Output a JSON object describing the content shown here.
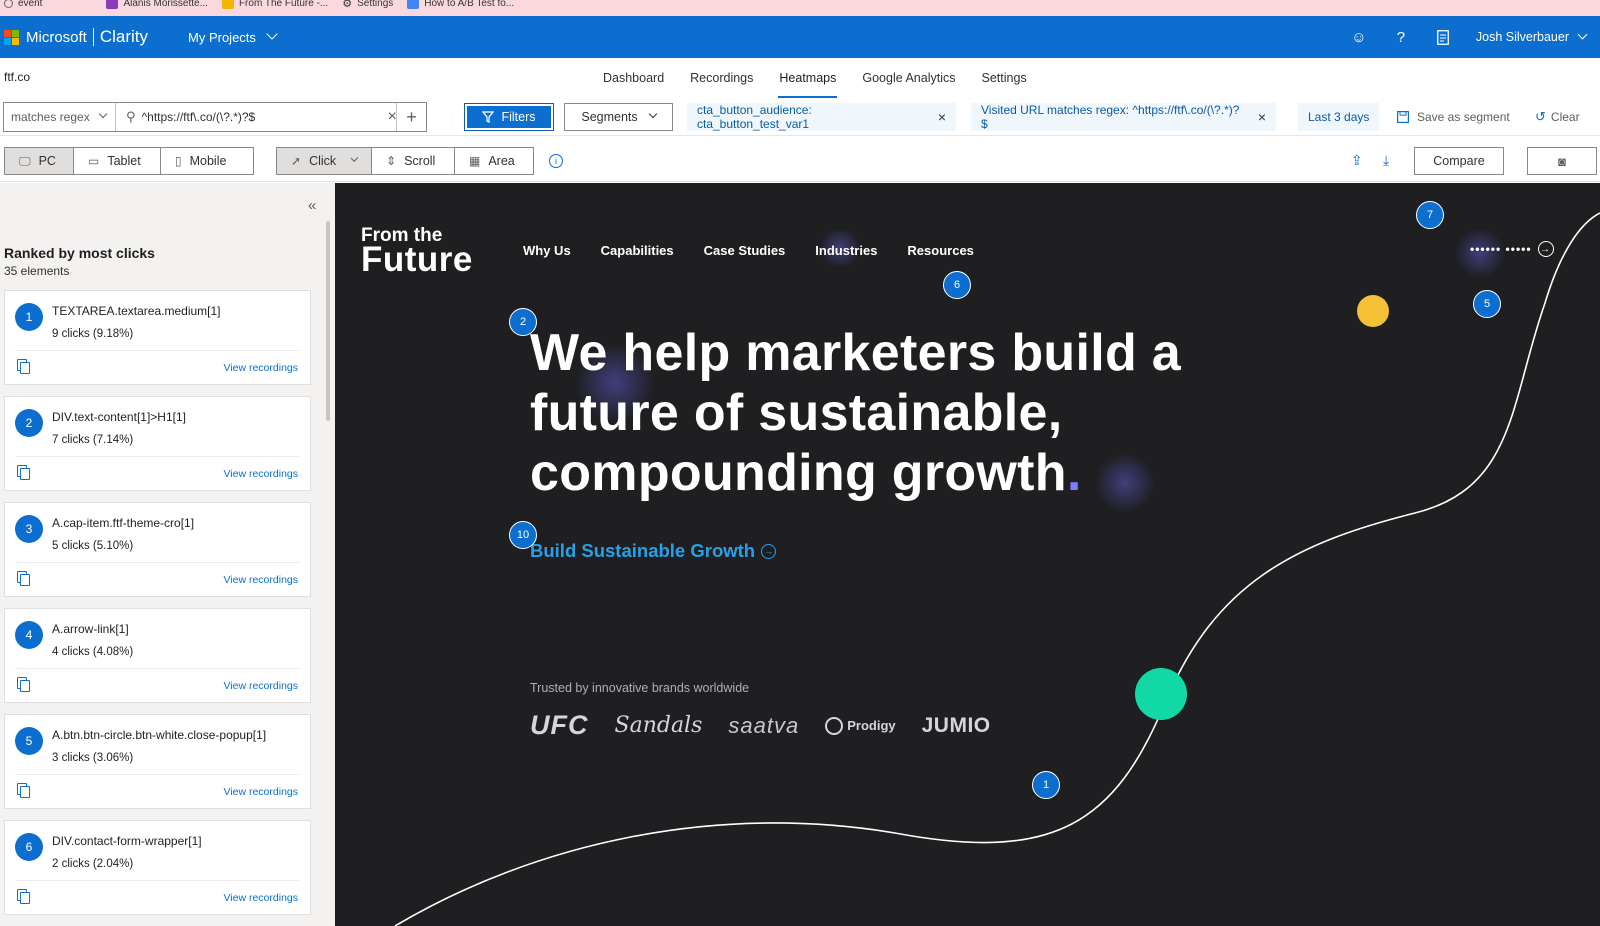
{
  "bookmarks": [
    {
      "label": "event",
      "color": "#666666"
    },
    {
      "label": "Alanis Morissette...",
      "color": "#8a3ab9"
    },
    {
      "label": "From The Future -...",
      "color": "#f4b400"
    },
    {
      "label": "Settings",
      "color": "#444444"
    },
    {
      "label": "How to A/B Test fo...",
      "color": "#4285f4"
    }
  ],
  "topbar": {
    "brand": "Microsoft",
    "product": "Clarity",
    "projects_label": "My Projects",
    "user": "Josh Silverbauer",
    "accent": "#0c6fd0"
  },
  "project": {
    "name": "ftf.co"
  },
  "tabs": [
    {
      "label": "Dashboard",
      "active": false
    },
    {
      "label": "Recordings",
      "active": false
    },
    {
      "label": "Heatmaps",
      "active": true
    },
    {
      "label": "Google Analytics",
      "active": false
    },
    {
      "label": "Settings",
      "active": false
    }
  ],
  "filters": {
    "match_type": "matches regex",
    "url_value": "^https://ftf\\.co/(\\?.*)?$",
    "filters_label": "Filters",
    "segments_label": "Segments",
    "chips": [
      "cta_button_audience: cta_button_test_var1",
      "Visited URL matches regex: ^https://ftf\\.co/(\\?.*)?$",
      "Last 3 days"
    ],
    "save_segment_label": "Save as segment",
    "clear_label": "Clear"
  },
  "devices": [
    {
      "label": "PC",
      "icon": "monitor-icon",
      "selected": true
    },
    {
      "label": "Tablet",
      "icon": "tablet-icon",
      "selected": false
    },
    {
      "label": "Mobile",
      "icon": "mobile-icon",
      "selected": false
    }
  ],
  "modes": [
    {
      "label": "Click",
      "icon": "cursor-icon",
      "selected": true
    },
    {
      "label": "Scroll",
      "icon": "scroll-icon",
      "selected": false
    },
    {
      "label": "Area",
      "icon": "area-icon",
      "selected": false
    }
  ],
  "toolbar": {
    "compare_label": "Compare"
  },
  "ranked": {
    "title": "Ranked by most clicks",
    "count": "35 elements",
    "view_label": "View recordings",
    "items": [
      {
        "rank": "1",
        "selector": "TEXTAREA.textarea.medium[1]",
        "clicks": "9 clicks (9.18%)"
      },
      {
        "rank": "2",
        "selector": "DIV.text-content[1]>H1[1]",
        "clicks": "7 clicks (7.14%)"
      },
      {
        "rank": "3",
        "selector": "A.cap-item.ftf-theme-cro[1]",
        "clicks": "5 clicks (5.10%)"
      },
      {
        "rank": "4",
        "selector": "A.arrow-link[1]",
        "clicks": "4 clicks (4.08%)"
      },
      {
        "rank": "5",
        "selector": "A.btn.btn-circle.btn-white.close-popup[1]",
        "clicks": "3 clicks (3.06%)"
      },
      {
        "rank": "6",
        "selector": "DIV.contact-form-wrapper[1]",
        "clicks": "2 clicks (2.04%)"
      }
    ]
  },
  "site": {
    "logo_line1": "From the",
    "logo_line2": "Future",
    "nav": [
      "Why Us",
      "Capabilities",
      "Case Studies",
      "Industries",
      "Resources"
    ],
    "contact": "•••••• •••••",
    "hero": "We help marketers build a future of sustainable, compounding growth",
    "hero_dot": ".",
    "cta": "Build Sustainable Growth",
    "trusted": "Trusted by innovative brands worldwide",
    "brands": [
      "UFC",
      "Sandals",
      "saatva",
      "Prodigy",
      "JUMIO"
    ],
    "background": "#1f1f22",
    "cta_color": "#28a0e8"
  },
  "markers": [
    "7",
    "6",
    "5",
    "2",
    "10",
    "1"
  ]
}
